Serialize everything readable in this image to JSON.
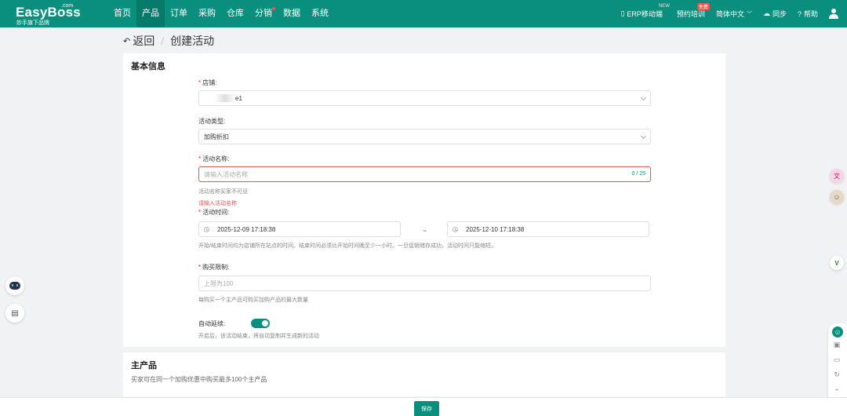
{
  "brand": {
    "name": "EasyBoss",
    "suffix": ".com",
    "tagline": "妙手旗下品牌",
    "primary_color": "#0a8f7e"
  },
  "nav": {
    "items": [
      {
        "label": "首页"
      },
      {
        "label": "产品"
      },
      {
        "label": "订单"
      },
      {
        "label": "采购"
      },
      {
        "label": "仓库"
      },
      {
        "label": "分销"
      },
      {
        "label": "数据"
      },
      {
        "label": "系统"
      }
    ],
    "active_index": 1
  },
  "tools": {
    "erp_mobile": "ERP移动端",
    "erp_mobile_badge": "NEW",
    "training": "预约培训",
    "training_badge": "免费",
    "language": "简体中文",
    "sync": "同步",
    "help": "帮助"
  },
  "breadcrumb": {
    "back": "返回",
    "separator": "/",
    "current": "创建活动"
  },
  "basic_info": {
    "title": "基本信息",
    "store": {
      "label": "店铺:",
      "value": "e1"
    },
    "activity_type": {
      "label": "活动类型:",
      "value": "加购折扣"
    },
    "activity_name": {
      "label": "活动名称:",
      "placeholder": "请输入活动名称",
      "counter": "0 / 25",
      "hint": "活动名称买家不可见",
      "error": "请输入活动名称"
    },
    "activity_time": {
      "label": "活动时间:",
      "start": "2025-12-09 17:18:38",
      "separator": "~",
      "end": "2025-12-10 17:18:38",
      "hint": "开始/结束时间均为店铺所在站点的时间。结束时间必须比开始时间晚至少一小时。一旦促销储存成功，活动时间只能缩短。"
    },
    "purchase_limit": {
      "label": "购买限制:",
      "placeholder": "上限为100",
      "hint": "每购买一个主产品可购买加购产品的最大数量"
    },
    "auto_renew": {
      "label": "自动延续:",
      "enabled": true,
      "hint": "开启后，该活动结束，将自动复制并生成新的活动"
    }
  },
  "main_product": {
    "title": "主产品",
    "desc": "买家可在同一个加购优惠中购买最多100个主产品"
  },
  "footer": {
    "save": "保存"
  }
}
